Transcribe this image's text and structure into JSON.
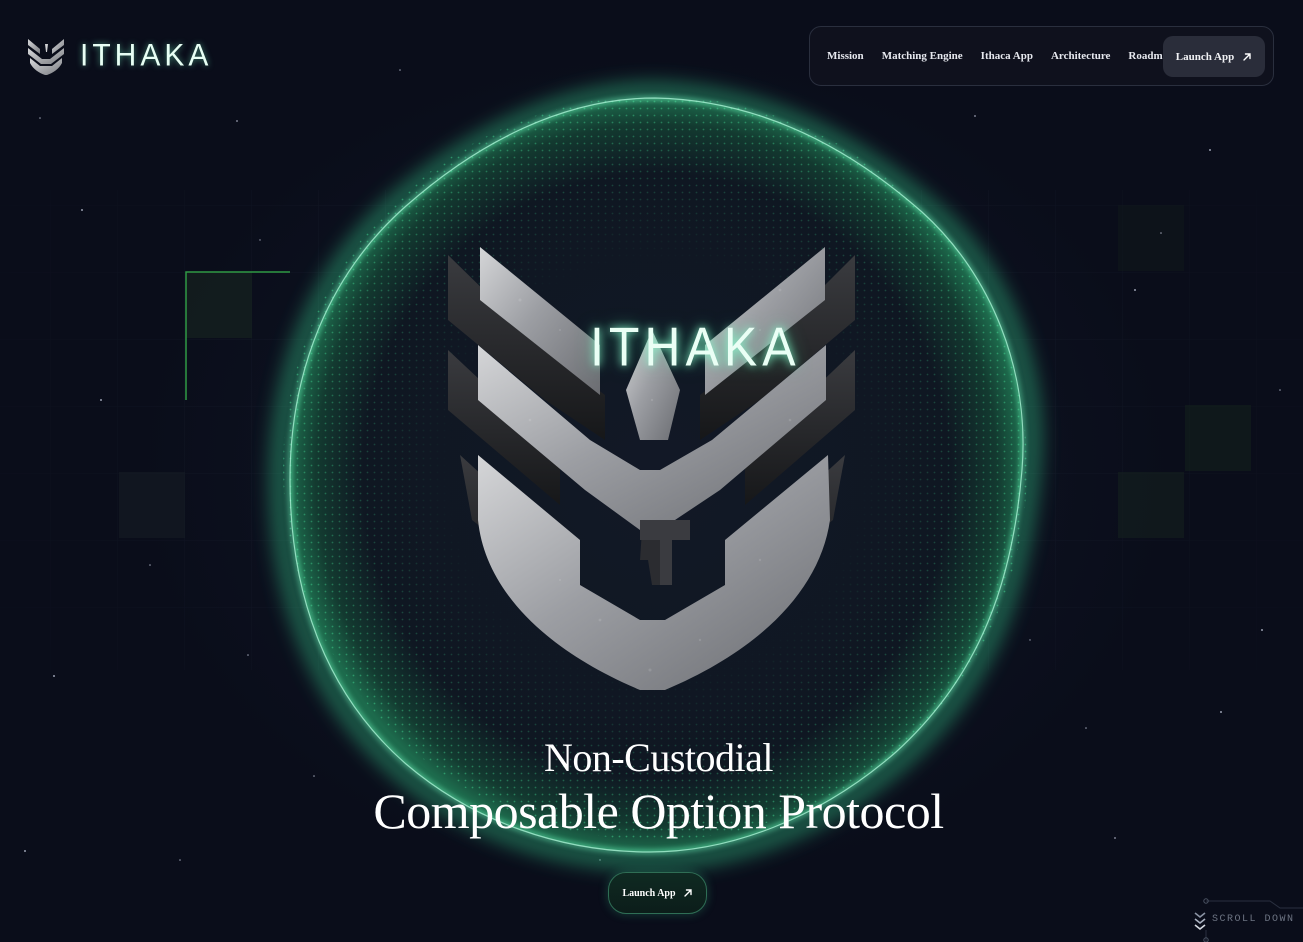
{
  "brand": {
    "wordmark": "ITHAKA",
    "logo_icon": "ithaca-emblem-icon"
  },
  "nav": {
    "items": [
      {
        "label": "Mission"
      },
      {
        "label": "Matching Engine"
      },
      {
        "label": "Ithaca App"
      },
      {
        "label": "Architecture"
      },
      {
        "label": "Roadmap"
      }
    ],
    "launch_label": "Launch App",
    "launch_icon": "arrow-up-right-icon"
  },
  "hero": {
    "emblem_wordmark": "ITHAKA",
    "headline_line1": "Non-Custodial",
    "headline_line2": "Composable Option Protocol",
    "cta_label": "Launch App",
    "cta_icon": "arrow-up-right-icon"
  },
  "scroll_hint": {
    "label": "SCROLL DOWN",
    "icon": "chevrons-down-icon"
  },
  "colors": {
    "background": "#0a0e1b",
    "accent_green": "#3ef0a0",
    "nav_bg": "#10131f",
    "button_bg": "#2a2d3a"
  }
}
